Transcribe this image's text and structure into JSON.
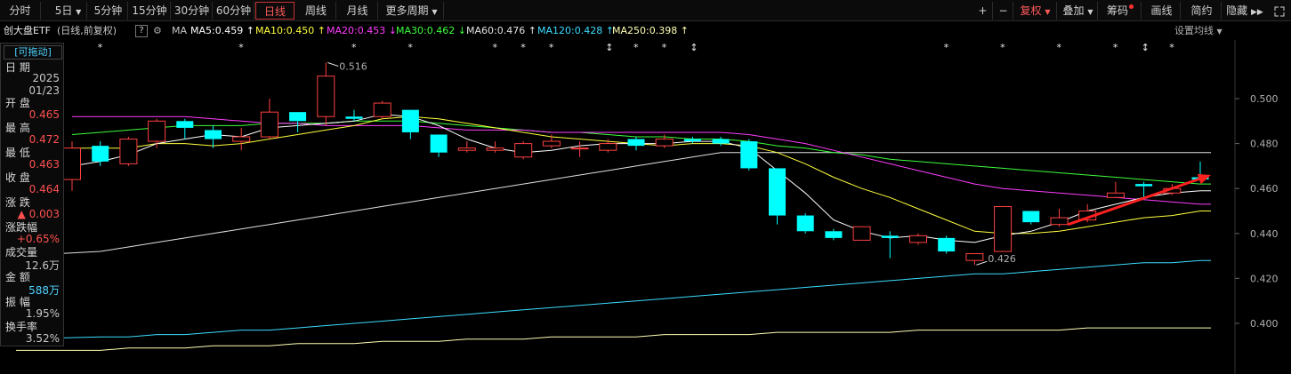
{
  "toolbar": {
    "periods": [
      "分时",
      "5日",
      "5分钟",
      "15分钟",
      "30分钟",
      "60分钟",
      "日线",
      "周线",
      "月线",
      "更多周期"
    ],
    "active_period": "日线",
    "right_tools": [
      "+",
      "−",
      "复权",
      "叠加",
      "筹码",
      "画线",
      "简约",
      "隐藏"
    ],
    "fuquan_label": "复权",
    "diejia_label": "叠加",
    "chouma_label": "筹码",
    "huaxian_label": "画线",
    "jianyue_label": "简约",
    "yincang_label": "隐藏"
  },
  "ma_bar": {
    "name": "创大盘ETF",
    "subtitle": "(日线,前复权)",
    "ma_prefix": "MA",
    "items": [
      {
        "label": "MA5:0.459",
        "arrow": "↑",
        "color": "#ffffff"
      },
      {
        "label": "MA10:0.450",
        "arrow": "↑",
        "color": "#ffff3c"
      },
      {
        "label": "MA20:0.453",
        "arrow": "↓",
        "color": "#ff3cff"
      },
      {
        "label": "MA30:0.462",
        "arrow": "↓",
        "color": "#3cff3c"
      },
      {
        "label": "MA60:0.476",
        "arrow": "↑",
        "color": "#e0e0e0"
      },
      {
        "label": "MA120:0.428",
        "arrow": "↑",
        "color": "#3cdcff"
      },
      {
        "label": "MA250:0.398",
        "arrow": "↑",
        "color": "#ffffb4"
      }
    ],
    "settings_label": "设置均线"
  },
  "info_panel": {
    "drag_label": "[可拖动]",
    "date_label": "日 期",
    "year": "2025",
    "date": "01/23",
    "open_label": "开 盘",
    "open": "0.465",
    "high_label": "最 高",
    "high": "0.472",
    "low_label": "最 低",
    "low": "0.463",
    "close_label": "收 盘",
    "close": "0.464",
    "change_label": "涨 跌",
    "change": "▲ 0.003",
    "pct_label": "涨跌幅",
    "pct": "+0.65%",
    "volume_label": "成交量",
    "volume": "12.6万",
    "amount_label": "金 额",
    "amount": "588万",
    "amplitude_label": "振 幅",
    "amplitude": "1.95%",
    "turnover_label": "换手率",
    "turnover": "3.52%"
  },
  "colors": {
    "up": "#ff4040",
    "down": "#00ffff",
    "bg": "#000000",
    "ma5": "#ffffff",
    "ma10": "#ffff3c",
    "ma20": "#ff3cff",
    "ma30": "#3cff3c",
    "ma60": "#e0e0e0",
    "ma120": "#3cdcff",
    "ma250": "#ffffb4",
    "arrow": "#ff2020"
  },
  "chart_data": {
    "type": "candlestick",
    "yticks": [
      "0.500",
      "0.480",
      "0.460",
      "0.440",
      "0.420",
      "0.400"
    ],
    "ylim": [
      0.392,
      0.514
    ],
    "annotations": [
      {
        "label": "0.516"
      },
      {
        "label": "0.426"
      }
    ],
    "candles": [
      {
        "o": 0.464,
        "h": 0.481,
        "l": 0.459,
        "c": 0.478
      },
      {
        "o": 0.479,
        "h": 0.481,
        "l": 0.47,
        "c": 0.472
      },
      {
        "o": 0.471,
        "h": 0.483,
        "l": 0.47,
        "c": 0.482
      },
      {
        "o": 0.481,
        "h": 0.491,
        "l": 0.478,
        "c": 0.49
      },
      {
        "o": 0.49,
        "h": 0.491,
        "l": 0.482,
        "c": 0.487
      },
      {
        "o": 0.486,
        "h": 0.488,
        "l": 0.478,
        "c": 0.482
      },
      {
        "o": 0.481,
        "h": 0.487,
        "l": 0.477,
        "c": 0.483
      },
      {
        "o": 0.483,
        "h": 0.5,
        "l": 0.482,
        "c": 0.494
      },
      {
        "o": 0.494,
        "h": 0.494,
        "l": 0.485,
        "c": 0.49
      },
      {
        "o": 0.492,
        "h": 0.516,
        "l": 0.488,
        "c": 0.51
      },
      {
        "o": 0.492,
        "h": 0.495,
        "l": 0.49,
        "c": 0.491
      },
      {
        "o": 0.492,
        "h": 0.499,
        "l": 0.491,
        "c": 0.498
      },
      {
        "o": 0.495,
        "h": 0.495,
        "l": 0.482,
        "c": 0.485
      },
      {
        "o": 0.484,
        "h": 0.484,
        "l": 0.474,
        "c": 0.476
      },
      {
        "o": 0.477,
        "h": 0.481,
        "l": 0.476,
        "c": 0.478
      },
      {
        "o": 0.477,
        "h": 0.481,
        "l": 0.476,
        "c": 0.478
      },
      {
        "o": 0.474,
        "h": 0.481,
        "l": 0.473,
        "c": 0.48
      },
      {
        "o": 0.479,
        "h": 0.484,
        "l": 0.478,
        "c": 0.481
      },
      {
        "o": 0.478,
        "h": 0.481,
        "l": 0.474,
        "c": 0.478
      },
      {
        "o": 0.477,
        "h": 0.482,
        "l": 0.476,
        "c": 0.48
      },
      {
        "o": 0.482,
        "h": 0.483,
        "l": 0.477,
        "c": 0.479
      },
      {
        "o": 0.479,
        "h": 0.484,
        "l": 0.478,
        "c": 0.482
      },
      {
        "o": 0.482,
        "h": 0.483,
        "l": 0.48,
        "c": 0.481
      },
      {
        "o": 0.482,
        "h": 0.483,
        "l": 0.479,
        "c": 0.48
      },
      {
        "o": 0.481,
        "h": 0.482,
        "l": 0.468,
        "c": 0.469
      },
      {
        "o": 0.469,
        "h": 0.469,
        "l": 0.444,
        "c": 0.448
      },
      {
        "o": 0.448,
        "h": 0.449,
        "l": 0.44,
        "c": 0.441
      },
      {
        "o": 0.441,
        "h": 0.442,
        "l": 0.437,
        "c": 0.438
      },
      {
        "o": 0.437,
        "h": 0.443,
        "l": 0.437,
        "c": 0.443
      },
      {
        "o": 0.439,
        "h": 0.441,
        "l": 0.429,
        "c": 0.438
      },
      {
        "o": 0.436,
        "h": 0.44,
        "l": 0.435,
        "c": 0.439
      },
      {
        "o": 0.438,
        "h": 0.439,
        "l": 0.431,
        "c": 0.432
      },
      {
        "o": 0.428,
        "h": 0.431,
        "l": 0.426,
        "c": 0.431
      },
      {
        "o": 0.432,
        "h": 0.452,
        "l": 0.432,
        "c": 0.452
      },
      {
        "o": 0.45,
        "h": 0.45,
        "l": 0.444,
        "c": 0.445
      },
      {
        "o": 0.444,
        "h": 0.451,
        "l": 0.443,
        "c": 0.447
      },
      {
        "o": 0.446,
        "h": 0.453,
        "l": 0.445,
        "c": 0.45
      },
      {
        "o": 0.456,
        "h": 0.463,
        "l": 0.456,
        "c": 0.458
      },
      {
        "o": 0.462,
        "h": 0.463,
        "l": 0.456,
        "c": 0.461
      },
      {
        "o": 0.458,
        "h": 0.462,
        "l": 0.457,
        "c": 0.46
      },
      {
        "o": 0.465,
        "h": 0.472,
        "l": 0.463,
        "c": 0.464
      }
    ],
    "ma_lines": {
      "ma5": [
        0.47,
        0.472,
        0.475,
        0.48,
        0.482,
        0.484,
        0.483,
        0.487,
        0.488,
        0.489,
        0.49,
        0.493,
        0.492,
        0.488,
        0.482,
        0.478,
        0.476,
        0.477,
        0.479,
        0.48,
        0.48,
        0.48,
        0.481,
        0.481,
        0.478,
        0.468,
        0.458,
        0.446,
        0.441,
        0.438,
        0.439,
        0.437,
        0.436,
        0.439,
        0.441,
        0.445,
        0.45,
        0.453,
        0.456,
        0.458,
        0.459
      ],
      "ma10": [
        0.478,
        0.478,
        0.478,
        0.48,
        0.48,
        0.479,
        0.48,
        0.482,
        0.484,
        0.486,
        0.488,
        0.491,
        0.492,
        0.491,
        0.489,
        0.487,
        0.485,
        0.483,
        0.482,
        0.481,
        0.48,
        0.479,
        0.48,
        0.48,
        0.479,
        0.476,
        0.471,
        0.465,
        0.46,
        0.456,
        0.451,
        0.446,
        0.441,
        0.44,
        0.44,
        0.441,
        0.443,
        0.445,
        0.447,
        0.448,
        0.45
      ],
      "ma20": [
        0.492,
        0.492,
        0.492,
        0.492,
        0.492,
        0.491,
        0.49,
        0.489,
        0.489,
        0.488,
        0.488,
        0.488,
        0.488,
        0.487,
        0.486,
        0.486,
        0.486,
        0.485,
        0.485,
        0.485,
        0.485,
        0.485,
        0.485,
        0.485,
        0.484,
        0.482,
        0.48,
        0.477,
        0.474,
        0.471,
        0.468,
        0.465,
        0.462,
        0.46,
        0.459,
        0.458,
        0.457,
        0.456,
        0.455,
        0.454,
        0.453
      ],
      "ma30": [
        0.484,
        0.485,
        0.486,
        0.487,
        0.488,
        0.488,
        0.488,
        0.489,
        0.489,
        0.489,
        0.49,
        0.49,
        0.49,
        0.489,
        0.488,
        0.487,
        0.486,
        0.485,
        0.485,
        0.484,
        0.483,
        0.483,
        0.482,
        0.482,
        0.481,
        0.479,
        0.478,
        0.476,
        0.475,
        0.473,
        0.472,
        0.471,
        0.47,
        0.469,
        0.468,
        0.467,
        0.466,
        0.465,
        0.464,
        0.463,
        0.462
      ],
      "ma60": [
        0.43,
        0.432,
        0.434,
        0.436,
        0.438,
        0.44,
        0.442,
        0.444,
        0.446,
        0.448,
        0.45,
        0.452,
        0.454,
        0.456,
        0.458,
        0.46,
        0.462,
        0.464,
        0.466,
        0.468,
        0.47,
        0.472,
        0.474,
        0.476,
        0.476,
        0.476,
        0.476,
        0.476,
        0.476,
        0.476,
        0.476,
        0.476,
        0.476,
        0.476,
        0.476,
        0.476,
        0.476,
        0.476,
        0.476,
        0.476,
        0.476
      ],
      "ma120": [
        0.393,
        0.394,
        0.394,
        0.395,
        0.395,
        0.396,
        0.397,
        0.397,
        0.398,
        0.399,
        0.4,
        0.401,
        0.402,
        0.403,
        0.404,
        0.405,
        0.406,
        0.407,
        0.408,
        0.409,
        0.41,
        0.411,
        0.412,
        0.413,
        0.414,
        0.415,
        0.416,
        0.417,
        0.418,
        0.419,
        0.42,
        0.421,
        0.422,
        0.422,
        0.423,
        0.424,
        0.425,
        0.426,
        0.427,
        0.427,
        0.428
      ],
      "ma250": [
        0.388,
        0.388,
        0.389,
        0.389,
        0.389,
        0.39,
        0.39,
        0.39,
        0.391,
        0.391,
        0.391,
        0.392,
        0.392,
        0.392,
        0.393,
        0.393,
        0.393,
        0.394,
        0.394,
        0.394,
        0.394,
        0.395,
        0.395,
        0.395,
        0.395,
        0.396,
        0.396,
        0.396,
        0.396,
        0.396,
        0.397,
        0.397,
        0.397,
        0.397,
        0.397,
        0.397,
        0.398,
        0.398,
        0.398,
        0.398,
        0.398
      ]
    },
    "markers": [
      "*",
      "*",
      "*",
      "*",
      "*",
      "*",
      "*",
      "↕",
      "*",
      "*",
      "↕",
      "*",
      "*",
      "*",
      "*",
      "↕",
      "*"
    ]
  }
}
